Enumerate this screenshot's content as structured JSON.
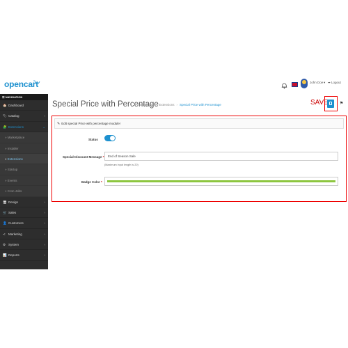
{
  "header": {
    "logo_text": "opencart",
    "logo_cart": "🛒",
    "user_name": "John Doe",
    "caret": "▾",
    "logout": "➦ Logout"
  },
  "sidebar": {
    "heading": "☰ NAVIGATION",
    "items": [
      {
        "icon": "🏠",
        "label": "Dashboard",
        "chevron": ""
      },
      {
        "icon": "🏷",
        "label": "Catalog",
        "chevron": "›"
      },
      {
        "icon": "🧩",
        "label": "Extensions",
        "chevron": "⌄"
      },
      {
        "icon": "»",
        "label": "Marketplace"
      },
      {
        "icon": "»",
        "label": "Installer"
      },
      {
        "icon": "»",
        "label": "Extensions"
      },
      {
        "icon": "»",
        "label": "Startup"
      },
      {
        "icon": "»",
        "label": "Events"
      },
      {
        "icon": "»",
        "label": "Cron Jobs"
      },
      {
        "icon": "🖥",
        "label": "Design",
        "chevron": "›"
      },
      {
        "icon": "🛒",
        "label": "Sales",
        "chevron": "›"
      },
      {
        "icon": "👤",
        "label": "Customers",
        "chevron": "›"
      },
      {
        "icon": "≺",
        "label": "Marketing",
        "chevron": "›"
      },
      {
        "icon": "⚙",
        "label": "System",
        "chevron": "›"
      },
      {
        "icon": "📊",
        "label": "Reports",
        "chevron": "›"
      }
    ]
  },
  "main": {
    "title": "Special Price with Percentage",
    "breadcrumbs": [
      "Dashboard",
      "Extensions",
      "Special Price with Percentage"
    ],
    "save_label": "SAVE",
    "panel_heading": "Edit special Price with percentage module!",
    "status_label": "Status",
    "message_label": "Special Discount Message",
    "message_value": "End of Season Sale",
    "message_help": "(Maximum input length is 20)",
    "badge_label": "Badge Color",
    "required_mark": "*"
  },
  "colors": {
    "brand": "#1e91cf",
    "sidebar_bg": "#2d2d2d",
    "highlight": "#ee0000",
    "badge_color": "#8dc63f"
  },
  "status_enabled": true
}
